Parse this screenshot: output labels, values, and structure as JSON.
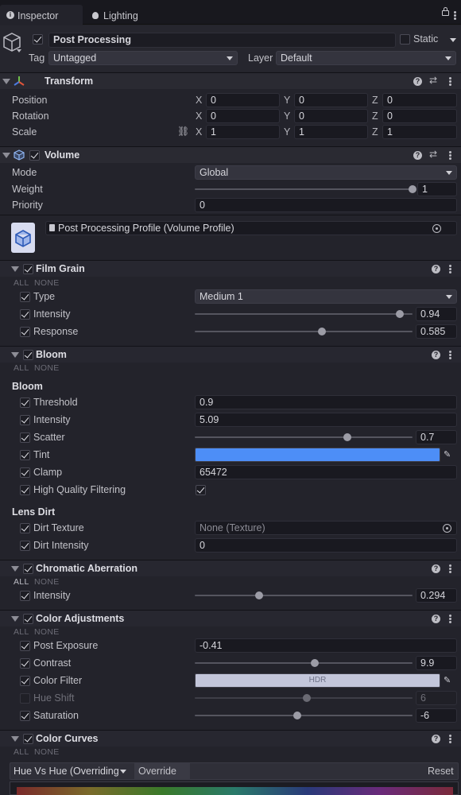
{
  "tabs": {
    "inspector": "Inspector",
    "lighting": "Lighting"
  },
  "object": {
    "name": "Post Processing",
    "static_label": "Static",
    "tag_label": "Tag",
    "tag_value": "Untagged",
    "layer_label": "Layer",
    "layer_value": "Default"
  },
  "transform": {
    "title": "Transform",
    "rows": [
      {
        "label": "Position",
        "x": "0",
        "y": "0",
        "z": "0"
      },
      {
        "label": "Rotation",
        "x": "0",
        "y": "0",
        "z": "0"
      },
      {
        "label": "Scale",
        "x": "1",
        "y": "1",
        "z": "1"
      }
    ],
    "axis": {
      "x": "X",
      "y": "Y",
      "z": "Z"
    }
  },
  "volume": {
    "title": "Volume",
    "mode_label": "Mode",
    "mode_value": "Global",
    "weight_label": "Weight",
    "weight_value": "1",
    "weight_fraction": 1.0,
    "priority_label": "Priority",
    "priority_value": "0",
    "profile_value": "Post Processing Profile (Volume Profile)"
  },
  "override_toggles": {
    "all": "ALL",
    "none": "NONE"
  },
  "film_grain": {
    "title": "Film Grain",
    "type_label": "Type",
    "type_value": "Medium 1",
    "intensity_label": "Intensity",
    "intensity_value": "0.94",
    "intensity_fraction": 0.94,
    "response_label": "Response",
    "response_value": "0.585",
    "response_fraction": 0.585
  },
  "bloom": {
    "title": "Bloom",
    "section_bloom": "Bloom",
    "threshold_label": "Threshold",
    "threshold_value": "0.9",
    "intensity_label": "Intensity",
    "intensity_value": "5.09",
    "scatter_label": "Scatter",
    "scatter_value": "0.7",
    "scatter_fraction": 0.7,
    "tint_label": "Tint",
    "tint_color": "#4d8ef7",
    "clamp_label": "Clamp",
    "clamp_value": "65472",
    "hq_label": "High Quality Filtering",
    "section_lens_dirt": "Lens Dirt",
    "dirt_texture_label": "Dirt Texture",
    "dirt_texture_value": "None (Texture)",
    "dirt_intensity_label": "Dirt Intensity",
    "dirt_intensity_value": "0"
  },
  "chromatic": {
    "title": "Chromatic Aberration",
    "intensity_label": "Intensity",
    "intensity_value": "0.294",
    "intensity_fraction": 0.294
  },
  "color_adjustments": {
    "title": "Color Adjustments",
    "post_exposure_label": "Post Exposure",
    "post_exposure_value": "-0.41",
    "contrast_label": "Contrast",
    "contrast_value": "9.9",
    "contrast_fraction": 0.55,
    "color_filter_label": "Color Filter",
    "color_filter_text": "HDR",
    "color_filter_color": "#c3c6da",
    "hue_shift_label": "Hue Shift",
    "hue_shift_value": "6",
    "saturation_label": "Saturation",
    "saturation_value": "-6",
    "saturation_fraction": 0.47
  },
  "color_curves": {
    "title": "Color Curves",
    "curve_select": "Hue Vs Hue (Overriding",
    "override_label": "Override",
    "reset_label": "Reset"
  }
}
